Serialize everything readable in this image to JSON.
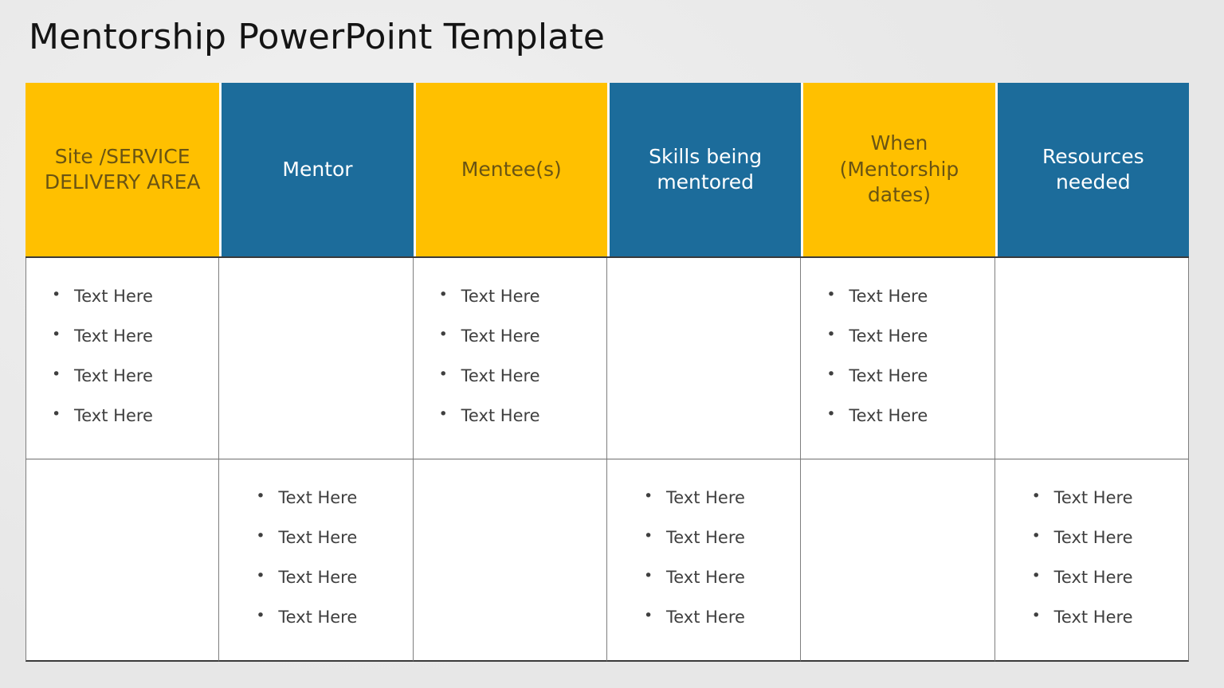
{
  "slide": {
    "title": "Mentorship PowerPoint Template",
    "background_color": "#ececec"
  },
  "colors": {
    "header_yellow": "#ffc000",
    "header_blue": "#1c6c9b",
    "header_yellow_text": "#6a5413",
    "header_blue_text": "#ffffff",
    "body_text": "#3f3f3f",
    "title_text": "#141414",
    "border": "#7e7e7e"
  },
  "table": {
    "columns": [
      {
        "label": "Site /SERVICE DELIVERY AREA",
        "style": "yellow"
      },
      {
        "label": "Mentor",
        "style": "blue"
      },
      {
        "label": "Mentee(s)",
        "style": "yellow"
      },
      {
        "label": "Skills being mentored",
        "style": "blue"
      },
      {
        "label": "When (Mentorship dates)",
        "style": "yellow"
      },
      {
        "label": "Resources needed",
        "style": "blue"
      }
    ],
    "rows": [
      {
        "cells": [
          {
            "bullets": [
              "Text Here",
              "Text Here",
              "Text Here",
              "Text Here"
            ]
          },
          {
            "bullets": []
          },
          {
            "bullets": [
              "Text Here",
              "Text Here",
              "Text Here",
              "Text Here"
            ]
          },
          {
            "bullets": []
          },
          {
            "bullets": [
              "Text Here",
              "Text Here",
              "Text Here",
              "Text Here"
            ]
          },
          {
            "bullets": []
          }
        ]
      },
      {
        "cells": [
          {
            "bullets": []
          },
          {
            "bullets": [
              "Text Here",
              "Text Here",
              "Text Here",
              "Text Here"
            ]
          },
          {
            "bullets": []
          },
          {
            "bullets": [
              "Text Here",
              "Text Here",
              "Text Here",
              "Text Here"
            ]
          },
          {
            "bullets": []
          },
          {
            "bullets": [
              "Text Here",
              "Text Here",
              "Text Here",
              "Text Here"
            ]
          }
        ]
      }
    ]
  }
}
